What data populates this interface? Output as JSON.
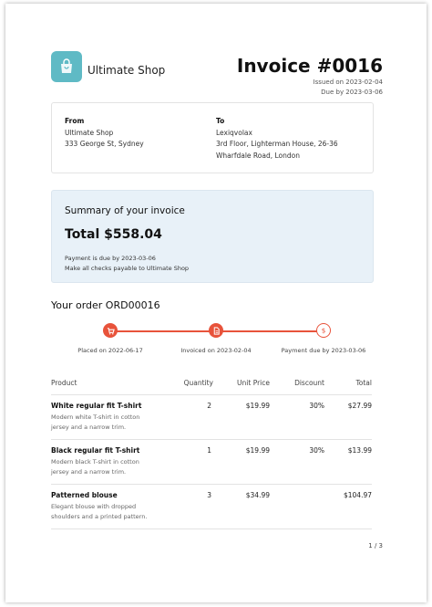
{
  "header": {
    "shop_name": "Ultimate Shop",
    "invoice_title": "Invoice #0016",
    "issued": "Issued on 2023-02-04",
    "due": "Due by 2023-03-06"
  },
  "addresses": {
    "from": {
      "heading": "From",
      "lines": [
        "Ultimate Shop",
        "333 George St, Sydney"
      ]
    },
    "to": {
      "heading": "To",
      "lines": [
        "Lexiqvolax",
        "3rd Floor, Lighterman House, 26-36",
        "Wharfdale Road, London"
      ]
    }
  },
  "summary": {
    "title": "Summary of your invoice",
    "total": "Total $558.04",
    "note1": "Payment is due by 2023-03-06",
    "note2": "Make all checks payable to Ultimate Shop"
  },
  "order": {
    "title": "Your order ORD00016",
    "timeline": [
      {
        "label": "Placed on 2022-06-17",
        "icon": "cart-icon"
      },
      {
        "label": "Invoiced on 2023-02-04",
        "icon": "document-icon"
      },
      {
        "label": "Payment due by 2023-03-06",
        "icon": "dollar-icon"
      }
    ]
  },
  "table": {
    "headers": [
      "Product",
      "Quantity",
      "Unit Price",
      "Discount",
      "Total"
    ],
    "rows": [
      {
        "name": "White regular fit T-shirt",
        "desc": "Modern white T-shirt in cotton jersey and a narrow trim.",
        "qty": "2",
        "price": "$19.99",
        "discount": "30%",
        "total": "$27.99"
      },
      {
        "name": "Black regular fit T-shirt",
        "desc": "Modern black T-shirt in cotton jersey and a narrow trim.",
        "qty": "1",
        "price": "$19.99",
        "discount": "30%",
        "total": "$13.99"
      },
      {
        "name": "Patterned blouse",
        "desc": "Elegant blouse with dropped shoulders and a printed pattern.",
        "qty": "3",
        "price": "$34.99",
        "discount": "",
        "total": "$104.97"
      }
    ]
  },
  "footer": {
    "page": "1 / 3"
  },
  "colors": {
    "accent": "#e8533b",
    "logo": "#5fbac5",
    "summary_bg": "#e8f1f8"
  }
}
